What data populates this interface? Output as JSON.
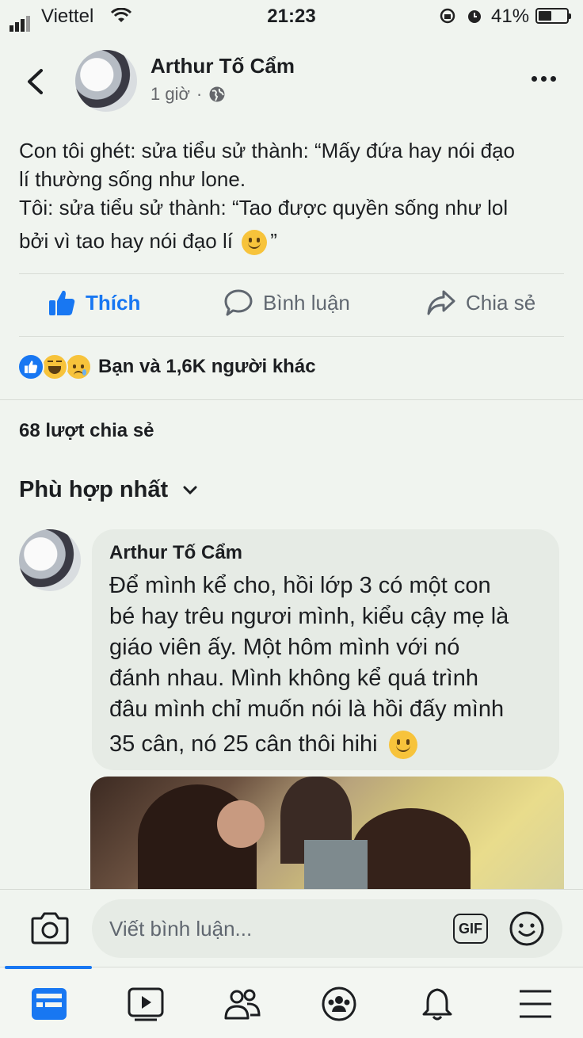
{
  "status_bar": {
    "carrier": "Viettel",
    "time": "21:23",
    "battery": "41%"
  },
  "post": {
    "author": "Arthur Tố Cẩm",
    "timestamp": "1 giờ",
    "separator": "·",
    "lines": [
      "Con tôi ghét: sửa tiểu sử thành: “Mấy đứa hay nói đạo",
      "lí thường sống như lone.",
      "Tôi: sửa tiểu sử thành: “Tao được quyền sống như lol",
      "bởi vì tao hay nói đạo lí",
      "”"
    ],
    "emoji": "🙂"
  },
  "actions": {
    "like": "Thích",
    "comment": "Bình luận",
    "share": "Chia sẻ"
  },
  "reactions": {
    "summary": "Bạn và 1,6K người khác",
    "icons": [
      "like-reaction",
      "haha-reaction",
      "sad-reaction"
    ]
  },
  "shares": "68 lượt chia sẻ",
  "sort": {
    "label": "Phù hợp nhất"
  },
  "comment": {
    "author": "Arthur Tố Cẩm",
    "lines": [
      "Để mình kể cho, hồi lớp 3 có một con",
      "bé hay trêu ngươi mình, kiểu cậy mẹ là",
      "giáo viên ấy. Một hôm mình với nó",
      "đánh nhau. Mình không kể quá trình",
      "đâu mình chỉ muốn nói là hồi đấy mình",
      "35 cân, nó 25 cân thôi hihi"
    ],
    "emoji": "🙂"
  },
  "composer": {
    "placeholder": "Viết bình luận...",
    "gif_label": "GIF"
  },
  "colors": {
    "accent": "#1877f2",
    "background": "#f0f4ef"
  },
  "nav": {
    "items": [
      "news-feed-icon",
      "watch-icon",
      "friends-icon",
      "groups-icon",
      "notifications-icon",
      "menu-icon"
    ],
    "active": "news-feed-icon"
  }
}
